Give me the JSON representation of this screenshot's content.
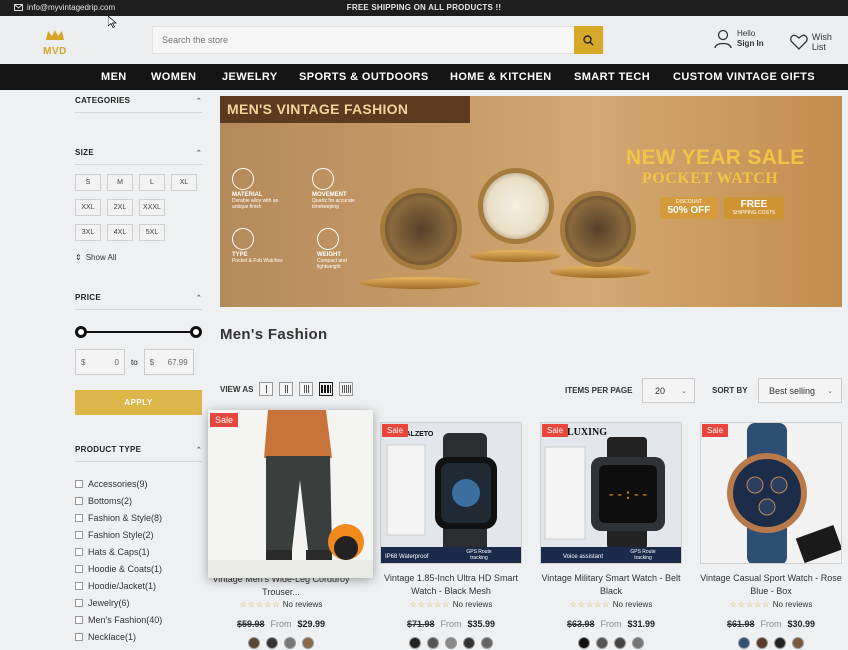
{
  "topbar": {
    "email": "info@myvintagedrip.com",
    "shipping": "FREE SHIPPING ON ALL PRODUCTS !!"
  },
  "header": {
    "logo": "MVD",
    "search_placeholder": "Search the store",
    "hello": "Hello",
    "signin": "Sign In",
    "wishlist": "Wish List"
  },
  "nav": [
    "MEN",
    "WOMEN",
    "JEWELRY",
    "SPORTS & OUTDOORS",
    "HOME & KITCHEN",
    "SMART TECH",
    "CUSTOM VINTAGE GIFTS"
  ],
  "sidebar": {
    "categories": "CATEGORIES",
    "size": "SIZE",
    "sizes": [
      "S",
      "M",
      "L",
      "XL",
      "XXL",
      "2XL",
      "XXXL",
      "3XL",
      "4XL",
      "5XL"
    ],
    "show_all": "Show All",
    "price": "PRICE",
    "price_min": "0",
    "price_max": "67.99",
    "currency": "$",
    "to": "to",
    "apply": "APPLY",
    "product_type": "PRODUCT TYPE",
    "types": [
      "Accessories(9)",
      "Bottoms(2)",
      "Fashion & Style(8)",
      "Fashion Style(2)",
      "Hats & Caps(1)",
      "Hoodie & Coats(1)",
      "Hoodie/Jacket(1)",
      "Jewelry(6)",
      "Men's Fashion(40)",
      "Necklace(1)"
    ]
  },
  "banner": {
    "title": "MEN'S VINTAGE FASHION",
    "sale_line1": "NEW YEAR SALE",
    "sale_line2": "POCKET WATCH",
    "discount_label": "DISCOUNT",
    "discount_value": "50% OFF",
    "free_label": "FREE",
    "free_sub": "SHIPPING COSTS",
    "features": [
      {
        "title": "MATERIAL",
        "text": "Durable alloy with an antique finish"
      },
      {
        "title": "MOVEMENT",
        "text": "Quartz for accurate timekeeping"
      },
      {
        "title": "TYPE",
        "text": "Pocket & Fob Watches"
      },
      {
        "title": "WEIGHT",
        "text": "Compact and lightweight"
      }
    ]
  },
  "main": {
    "title": "Men's Fashion",
    "view_as": "VIEW AS",
    "items_per_page_label": "ITEMS PER PAGE",
    "items_per_page": "20",
    "sort_by_label": "SORT BY",
    "sort_by": "Best selling"
  },
  "products": [
    {
      "sale": "Sale",
      "name": "Vintage Men's Wide-Leg Corduroy Trouser...",
      "reviews": "No reviews",
      "old": "$59.98",
      "from": "From",
      "price": "$29.99"
    },
    {
      "sale": "Sale",
      "name": "Vintage 1.85-Inch Ultra HD Smart Watch - Black Mesh",
      "reviews": "No reviews",
      "old": "$71.98",
      "from": "From",
      "price": "$35.99",
      "brand": "BOALZETO",
      "tag1": "IP68 Waterproof",
      "tag2": "GPS Route tracking"
    },
    {
      "sale": "Sale",
      "name": "Vintage Military Smart Watch - Belt Black",
      "reviews": "No reviews",
      "old": "$63.98",
      "from": "From",
      "price": "$31.99",
      "brand": "LUXING",
      "tag1": "Voice assistant",
      "tag2": "GPS Route tracking"
    },
    {
      "sale": "Sale",
      "name": "Vintage Casual Sport Watch - Rose Blue - Box",
      "reviews": "No reviews",
      "old": "$61.98",
      "from": "From",
      "price": "$30.99"
    }
  ],
  "colors": {
    "accent": "#d8a82a",
    "nav_bg": "#141414",
    "sale": "#e8453c"
  }
}
